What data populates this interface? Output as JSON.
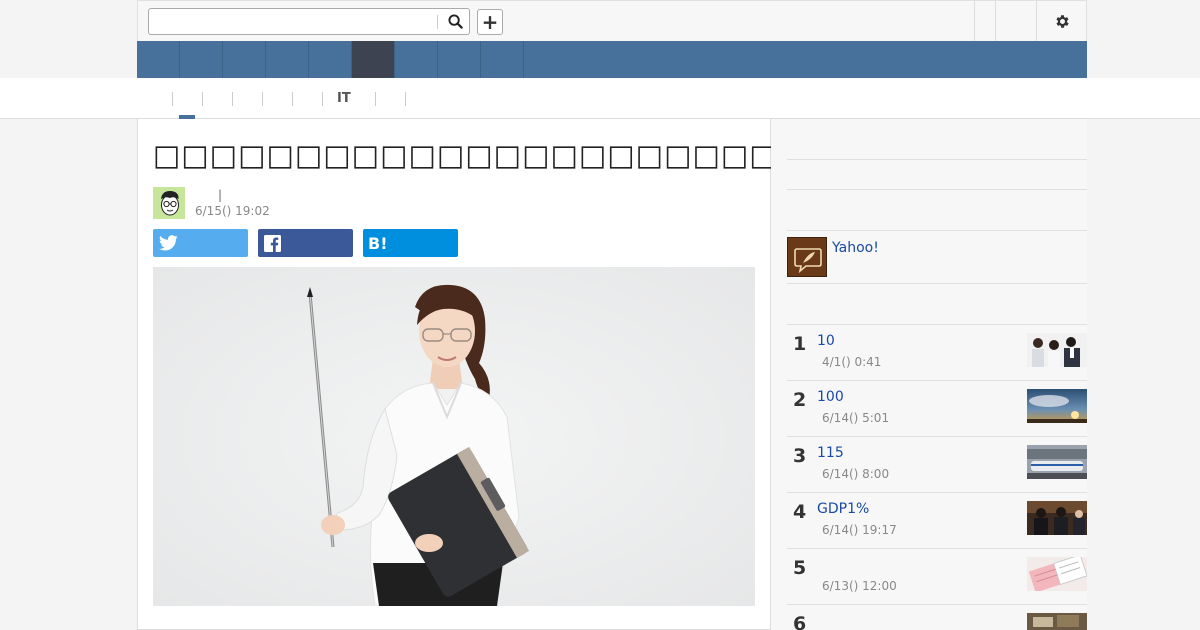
{
  "header": {
    "search_value": "",
    "search_icon": "magnifier-icon",
    "add_label": "+",
    "settings_icon": "gear-icon"
  },
  "subnav": {
    "it_label": "IT"
  },
  "article": {
    "title": "□□□□□□□□□□□□□□□□□□□□□□",
    "author_separator": "|",
    "date": "6/15() 19:02"
  },
  "share": {
    "twitter_icon": "twitter-icon",
    "facebook_icon": "facebook-icon",
    "hatena_label": "B!"
  },
  "sidebar": {
    "yahoo_link": "Yahoo!",
    "ranking": [
      {
        "rank": "1",
        "title": "10",
        "date": "4/1() 0:41"
      },
      {
        "rank": "2",
        "title": "100",
        "date": "6/14() 5:01"
      },
      {
        "rank": "3",
        "title": "115",
        "date": "6/14() 8:00"
      },
      {
        "rank": "4",
        "title": "GDP1%",
        "date": "6/14() 19:17"
      },
      {
        "rank": "5",
        "title": "",
        "date": "6/13() 12:00"
      },
      {
        "rank": "6",
        "title": "",
        "date": ""
      }
    ]
  },
  "colors": {
    "nav_blue": "#47719a",
    "nav_active": "#3e4352",
    "link_blue": "#1a4aa5",
    "twitter": "#55acee",
    "facebook": "#3b5998",
    "hatena": "#008fde"
  }
}
